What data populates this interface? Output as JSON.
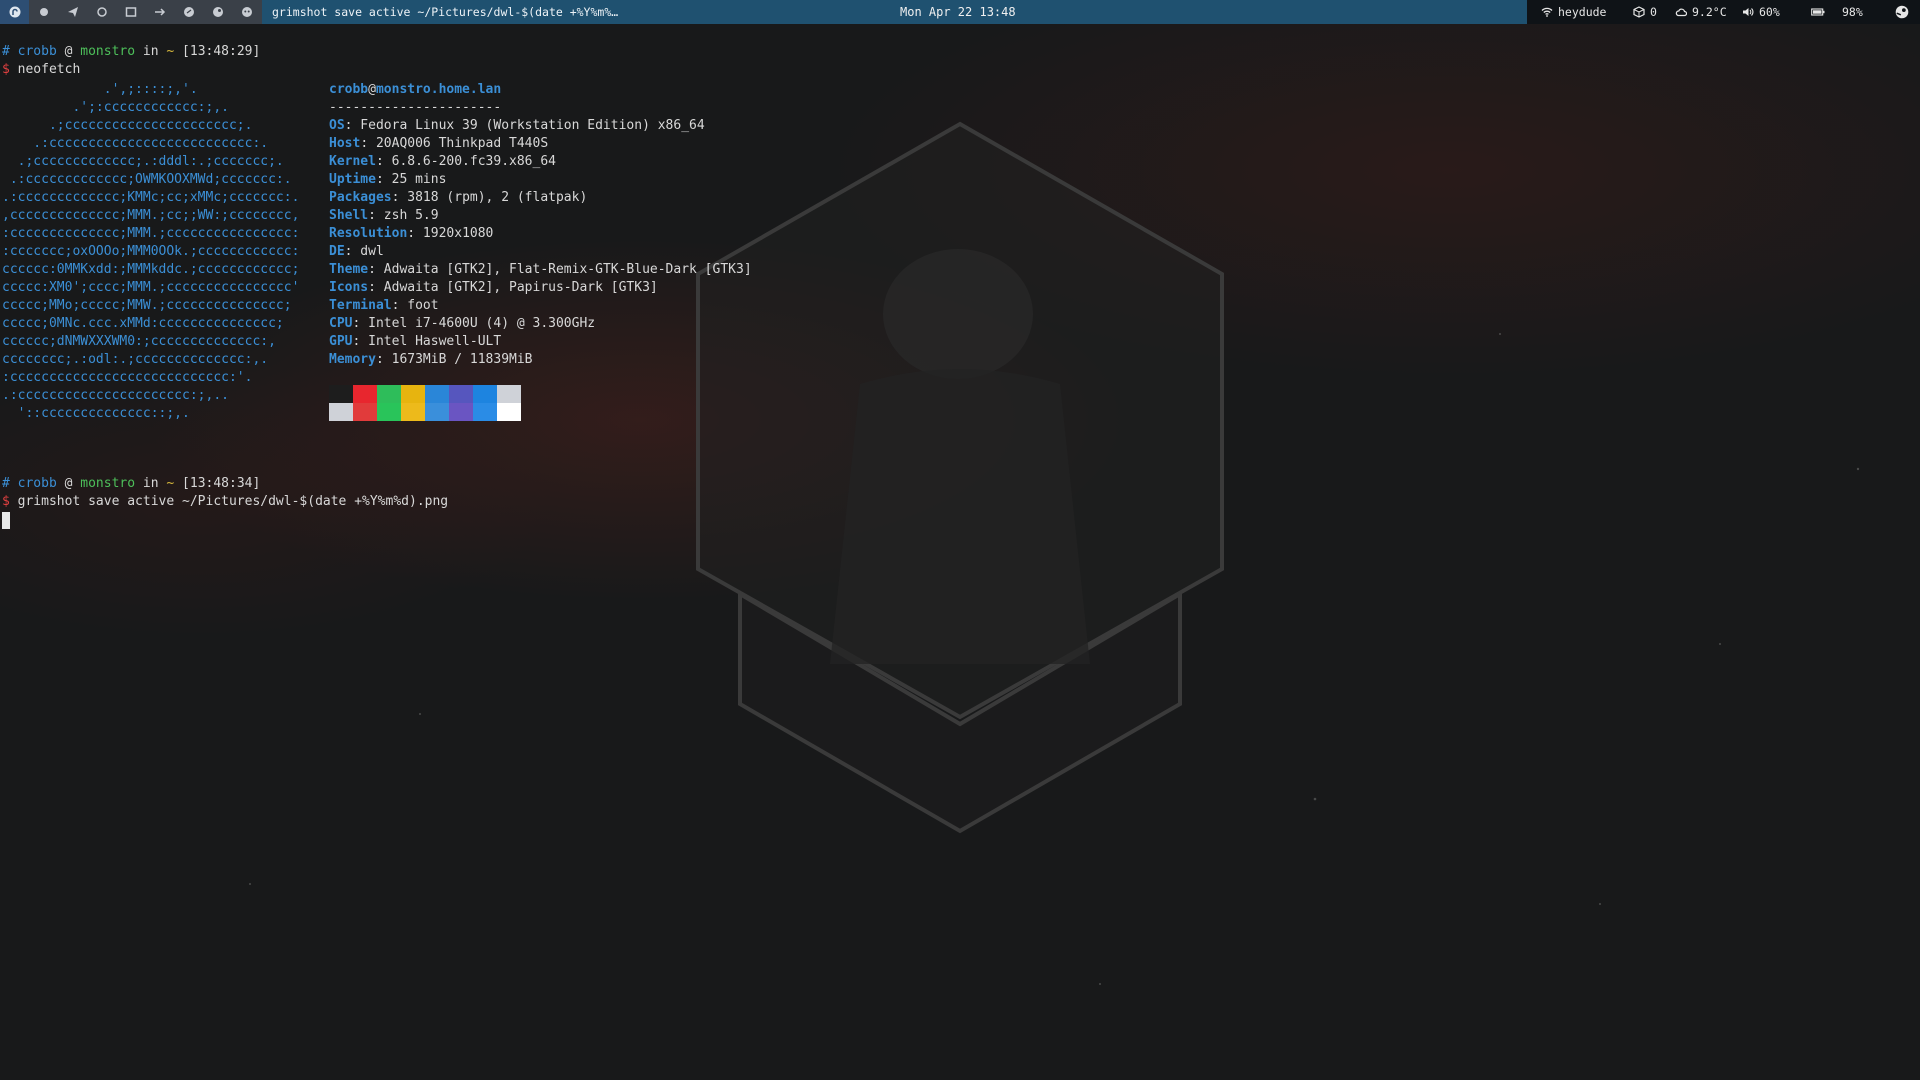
{
  "topbar": {
    "tags": [
      {
        "icon": "fedora-icon",
        "active": true
      },
      {
        "icon": "dot-icon"
      },
      {
        "icon": "send-icon"
      },
      {
        "icon": "circle-icon"
      },
      {
        "icon": "window-icon"
      },
      {
        "icon": "arrow-icon"
      },
      {
        "icon": "chat-icon"
      },
      {
        "icon": "steam-icon"
      },
      {
        "icon": "mask-icon"
      }
    ],
    "window_title": "grimshot save active ~/Pictures/dwl-$(date +%Y%m%…",
    "clock": "Mon Apr 22  13:48",
    "status": {
      "wifi": "heydude",
      "updates": "0",
      "weather": "9.2°C",
      "volume": "60%",
      "battery": "98%"
    }
  },
  "terminal": {
    "prompt1": {
      "hash": "#",
      "user": "crobb",
      "at": "@",
      "host": "monstro",
      "in": "in",
      "dir": "~",
      "time": "[13:48:29]"
    },
    "cmd1": {
      "sym": "$",
      "text": "neofetch"
    },
    "ascii": [
      "             .',;::::;,'.",
      "         .';:cccccccccccc:;,.",
      "      .;cccccccccccccccccccccc;.",
      "    .:cccccccccccccccccccccccccc:.",
      "  .;ccccccccccccc;.:dddl:.;ccccccc;.",
      " .:ccccccccccccc;OWMKOOXMWd;ccccccc:.",
      ".:ccccccccccccc;KMMc;cc;xMMc;ccccccc:.",
      ",cccccccccccccc;MMM.;cc;;WW:;cccccccc,",
      ":cccccccccccccc;MMM.;cccccccccccccccc:",
      ":ccccccc;oxOOOo;MMM0OOk.;cccccccccccc:",
      "cccccc:0MMKxdd:;MMMkddc.;cccccccccccc;",
      "ccccc:XM0';cccc;MMM.;cccccccccccccccc'",
      "ccccc;MMo;ccccc;MMW.;ccccccccccccccc;",
      "ccccc;0MNc.ccc.xMMd:ccccccccccccccc;",
      "cccccc;dNMWXXXWM0:;cccccccccccccc:,",
      "cccccccc;.:odl:.;cccccccccccccc:,.",
      ":cccccccccccccccccccccccccccc:'.",
      ".:cccccccccccccccccccccc:;,..",
      "  '::cccccccccccccc::;,."
    ],
    "info": {
      "user": "crobb",
      "at": "@",
      "host": "monstro.home.lan",
      "separator": "----------------------",
      "rows": [
        {
          "key": "OS",
          "value": ": Fedora Linux 39 (Workstation Edition) x86_64"
        },
        {
          "key": "Host",
          "value": ": 20AQ006 Thinkpad T440S"
        },
        {
          "key": "Kernel",
          "value": ": 6.8.6-200.fc39.x86_64"
        },
        {
          "key": "Uptime",
          "value": ": 25 mins"
        },
        {
          "key": "Packages",
          "value": ": 3818 (rpm), 2 (flatpak)"
        },
        {
          "key": "Shell",
          "value": ": zsh 5.9"
        },
        {
          "key": "Resolution",
          "value": ": 1920x1080"
        },
        {
          "key": "DE",
          "value": ": dwl"
        },
        {
          "key": "Theme",
          "value": ": Adwaita [GTK2], Flat-Remix-GTK-Blue-Dark [GTK3]"
        },
        {
          "key": "Icons",
          "value": ": Adwaita [GTK2], Papirus-Dark [GTK3]"
        },
        {
          "key": "Terminal",
          "value": ": foot"
        },
        {
          "key": "CPU",
          "value": ": Intel i7-4600U (4) @ 3.300GHz"
        },
        {
          "key": "GPU",
          "value": ": Intel Haswell-ULT"
        },
        {
          "key": "Memory",
          "value": ": 1673MiB / 11839MiB"
        }
      ],
      "palette_top": [
        "#1d1d1d",
        "#e8262e",
        "#2ebd5a",
        "#e7b40f",
        "#2a86d8",
        "#5656be",
        "#1d84e0",
        "#cfd2d8"
      ],
      "palette_bottom": [
        "#cfd2d8",
        "#e13b3b",
        "#29c45a",
        "#edba1b",
        "#3a8fdb",
        "#6a55c2",
        "#2a8ce6",
        "#ffffff"
      ]
    },
    "prompt2": {
      "hash": "#",
      "user": "crobb",
      "at": "@",
      "host": "monstro",
      "in": "in",
      "dir": "~",
      "time": "[13:48:34]"
    },
    "cmd2": {
      "sym": "$",
      "text": "grimshot save active ~/Pictures/dwl-$(date +%Y%m%d).png"
    }
  }
}
